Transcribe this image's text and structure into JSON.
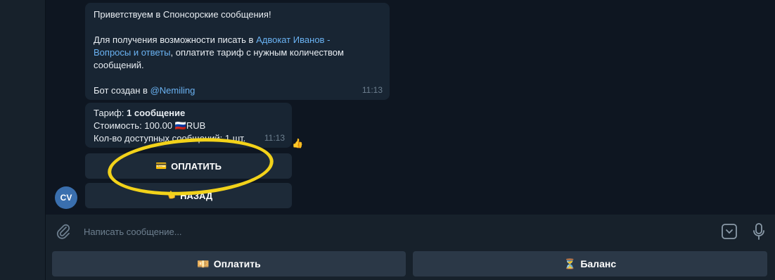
{
  "messages": {
    "welcome": {
      "greeting": "Приветствуем в Спонсорские сообщения!",
      "body_part1": "Для получения возможности писать в ",
      "body_link": "Адвокат Иванов - Вопросы и ответы",
      "body_part2": ", оплатите тариф с нужным количеством сообщений.",
      "footer_part1": "Бот создан в ",
      "footer_link": "@Nemiling",
      "time": "11:13"
    },
    "tariff": {
      "tariff_label": "Тариф: ",
      "tariff_value": "1 сообщение",
      "price_label": "Стоимость: 100.00 ",
      "price_flag": "🇷🇺",
      "price_currency": "RUB",
      "available_label": "Кол-во доступных сообщений: 1 шт.",
      "time": "11:13",
      "reaction": "👍"
    }
  },
  "inline_buttons": {
    "pay": {
      "icon": "💳",
      "label": "ОПЛАТИТЬ"
    },
    "back": {
      "icon": "👈",
      "label": "НАЗАД"
    }
  },
  "avatar": {
    "initials": "CV",
    "color": "#3a6fae"
  },
  "composer": {
    "placeholder": "Написать сообщение..."
  },
  "keyboard": {
    "pay": {
      "icon": "💴",
      "label": "Оплатить"
    },
    "balance": {
      "icon": "⏳",
      "label": "Баланс"
    }
  },
  "colors": {
    "background": "#0e1621",
    "bubble": "#182533",
    "link": "#6ab2f2",
    "highlight": "#f2d21a"
  }
}
